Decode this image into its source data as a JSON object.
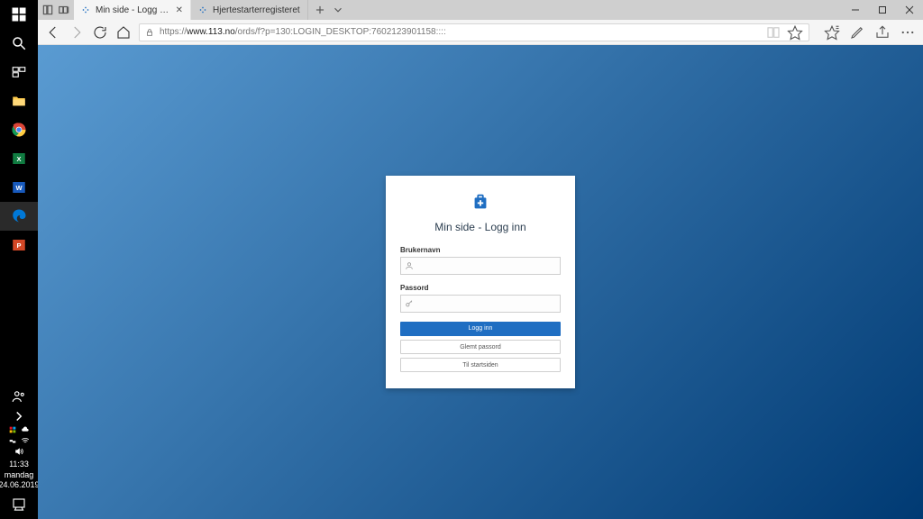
{
  "taskbar": {
    "clock_time": "11:33",
    "clock_day": "mandag",
    "clock_date": "24.06.2019"
  },
  "titlebar": {
    "tab1_title": "Min side - Logg inn",
    "tab2_title": "Hjertestarterregisteret"
  },
  "addressbar": {
    "url_prefix": "https://",
    "url_host": "www.113.no",
    "url_path": "/ords/f?p=130:LOGIN_DESKTOP:7602123901158::::"
  },
  "login": {
    "title": "Min side - Logg inn",
    "username_label": "Brukernavn",
    "password_label": "Passord",
    "submit_label": "Logg inn",
    "forgot_label": "Glemt passord",
    "home_label": "Til startsiden"
  }
}
